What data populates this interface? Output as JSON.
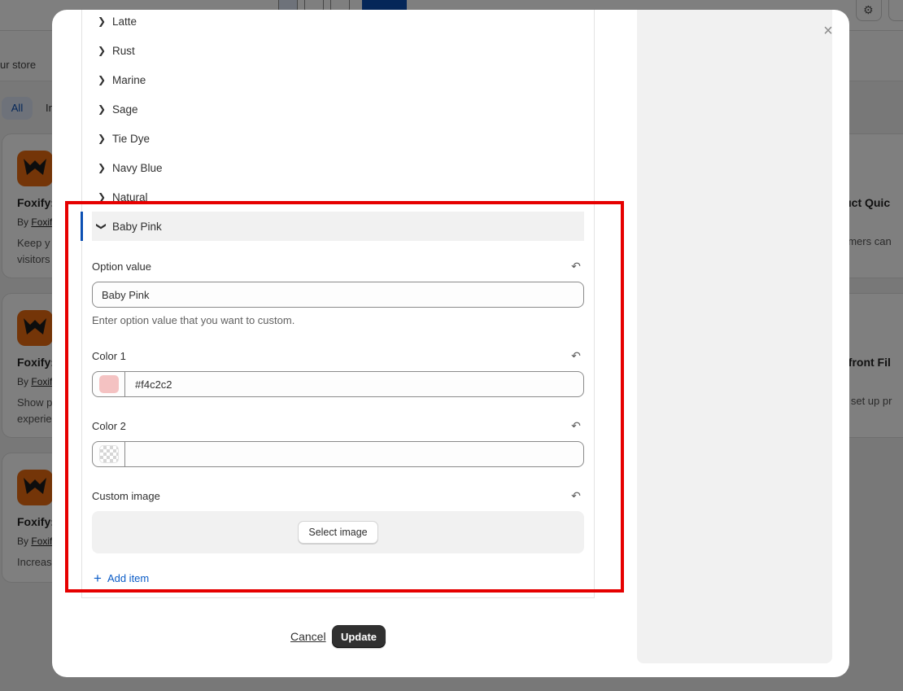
{
  "background": {
    "store_text": "ur store",
    "tabs": {
      "all": "All",
      "next_partial": "In"
    },
    "cards": [
      {
        "title": "Foxify:",
        "by_prefix": "By",
        "by_link": "Foxif",
        "desc_line1": "Keep y",
        "desc_line2": "visitors"
      },
      {
        "title": "Foxify:",
        "by_prefix": "By",
        "by_link": "Foxif",
        "desc_line1": "Show p",
        "desc_line2": "experie"
      },
      {
        "title": "Foxify:",
        "by_prefix": "By",
        "by_link": "Foxif",
        "desc_line1": "Increas",
        "desc_line2": ""
      }
    ],
    "right_cards": [
      {
        "title": "oduct Quic",
        "desc": "omers can"
      },
      {
        "title": "orefront Fil",
        "desc": "o set up pr"
      }
    ]
  },
  "modal": {
    "close_icon": "×",
    "options": [
      {
        "label": "Latte"
      },
      {
        "label": "Rust"
      },
      {
        "label": "Marine"
      },
      {
        "label": "Sage"
      },
      {
        "label": "Tie Dye"
      },
      {
        "label": "Navy Blue"
      },
      {
        "label": "Natural"
      }
    ],
    "active_option": {
      "label": "Baby Pink",
      "option_value_label": "Option value",
      "option_value": "Baby Pink",
      "option_value_help": "Enter option value that you want to custom.",
      "color1_label": "Color 1",
      "color1_value": "#f4c2c2",
      "color1_swatch": "#f4c2c2",
      "color2_label": "Color 2",
      "color2_value": "",
      "custom_image_label": "Custom image",
      "select_image_button": "Select image"
    },
    "add_item": "Add item",
    "cancel": "Cancel",
    "update": "Update",
    "icons": {
      "reset": "reset-icon",
      "chevron_right": "chevron-right-icon",
      "chevron_down": "chevron-down-icon",
      "plus": "plus-icon",
      "close": "close-icon"
    }
  }
}
